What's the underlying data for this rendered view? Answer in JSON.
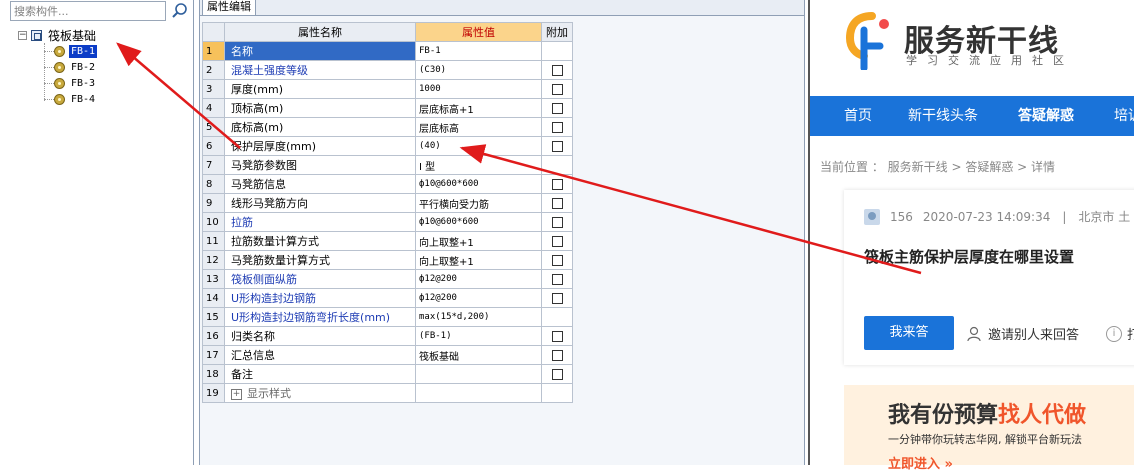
{
  "left_panel": {
    "search_placeholder": "搜索构件...",
    "tree": {
      "root_label": "筏板基础",
      "expander": "−",
      "items": [
        "FB-1",
        "FB-2",
        "FB-3",
        "FB-4"
      ]
    }
  },
  "editor": {
    "tab_label": "属性编辑",
    "columns": {
      "name": "属性名称",
      "value": "属性值",
      "extra": "附加"
    },
    "rows": [
      {
        "n": "1",
        "name": "名称",
        "value": "FB-1",
        "checkbox": false
      },
      {
        "n": "2",
        "name": "混凝土强度等级",
        "value": "(C30)",
        "checkbox": true
      },
      {
        "n": "3",
        "name": "厚度(mm)",
        "value": "1000",
        "checkbox": true
      },
      {
        "n": "4",
        "name": "顶标高(m)",
        "value": "层底标高+1",
        "checkbox": true
      },
      {
        "n": "5",
        "name": "底标高(m)",
        "value": "层底标高",
        "checkbox": true
      },
      {
        "n": "6",
        "name": "保护层厚度(mm)",
        "value": "(40)",
        "checkbox": true
      },
      {
        "n": "7",
        "name": "马凳筋参数图",
        "value": "I 型",
        "checkbox": false
      },
      {
        "n": "8",
        "name": "马凳筋信息",
        "value": "ф10@600*600",
        "checkbox": true
      },
      {
        "n": "9",
        "name": "线形马凳筋方向",
        "value": "平行横向受力筋",
        "checkbox": true
      },
      {
        "n": "10",
        "name": "拉筋",
        "value": "ф10@600*600",
        "checkbox": true
      },
      {
        "n": "11",
        "name": "拉筋数量计算方式",
        "value": "向上取整+1",
        "checkbox": true
      },
      {
        "n": "12",
        "name": "马凳筋数量计算方式",
        "value": "向上取整+1",
        "checkbox": true
      },
      {
        "n": "13",
        "name": "筏板侧面纵筋",
        "value": "ф12@200",
        "checkbox": true
      },
      {
        "n": "14",
        "name": "U形构造封边钢筋",
        "value": "ф12@200",
        "checkbox": true
      },
      {
        "n": "15",
        "name": "U形构造封边钢筋弯折长度(mm)",
        "value": "max(15*d,200)",
        "checkbox": false
      },
      {
        "n": "16",
        "name": "归类名称",
        "value": "(FB-1)",
        "checkbox": true
      },
      {
        "n": "17",
        "name": "汇总信息",
        "value": "筏板基础",
        "checkbox": true
      },
      {
        "n": "18",
        "name": "备注",
        "value": "",
        "checkbox": true
      },
      {
        "n": "19",
        "name": "显示样式",
        "value": "",
        "checkbox": false
      }
    ],
    "expand_symbol": "+"
  },
  "website": {
    "logo_text": "服务新干线",
    "logo_sub": "学习交流应用社区",
    "nav": [
      "首页",
      "新干线头条",
      "答疑解惑",
      "培训"
    ],
    "breadcrumb": "当前位置 ： 服务新干线 > 答疑解惑 > 详情",
    "question": {
      "views": "156",
      "date": "2020-07-23 14:09:34",
      "separator": "|",
      "location": "北京市 土",
      "title": "筏板主筋保护层厚度在哪里设置",
      "answer_button": "我来答",
      "invite": "邀请别人来回答",
      "info_symbol": "i",
      "info_tail": "打"
    },
    "banner": {
      "title_plain": "我有份预算",
      "title_hot": "找人代做",
      "subtitle": "一分钟带你玩转志华网, 解锁平台新玩法",
      "link": "立即进入 »"
    }
  },
  "colors": {
    "nav_blue": "#1a73d9",
    "header_orange": "#fbd48b",
    "arrow_red": "#e01b1b",
    "tree_selected": "#0b3cc7"
  }
}
